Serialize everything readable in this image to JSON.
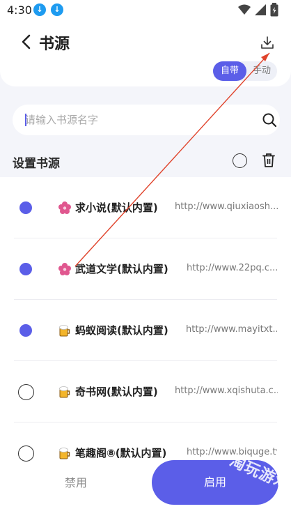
{
  "status": {
    "time": "4:30"
  },
  "header": {
    "title": "书源",
    "toggle_on": "自带",
    "toggle_off": "手动"
  },
  "search": {
    "placeholder": "请输入书源名字"
  },
  "section": {
    "title": "设置书源"
  },
  "sources": [
    {
      "name": "求小说(默认内置)",
      "url": "http://www.qiuxiaosh...",
      "checked": true,
      "icon": "flower-icon"
    },
    {
      "name": "武道文学(默认内置)",
      "url": "http://www.22pq.c...",
      "checked": true,
      "icon": "flower-icon"
    },
    {
      "name": "蚂蚁阅读(默认内置)",
      "url": "http://www.mayitxt...",
      "checked": true,
      "icon": "beer-icon"
    },
    {
      "name": "奇书网(默认内置)",
      "url": "http://www.xqishuta.c...",
      "checked": false,
      "icon": "beer-icon"
    },
    {
      "name": "笔趣阁⑧(默认内置)",
      "url": "http://www.biquge.tv",
      "checked": false,
      "icon": "beer-icon"
    }
  ],
  "buttons": {
    "disable": "禁用",
    "enable": "启用"
  },
  "watermark": "淘玩游戏",
  "colors": {
    "accent": "#5b5ee8",
    "annotation_arrow": "#e0432b"
  }
}
